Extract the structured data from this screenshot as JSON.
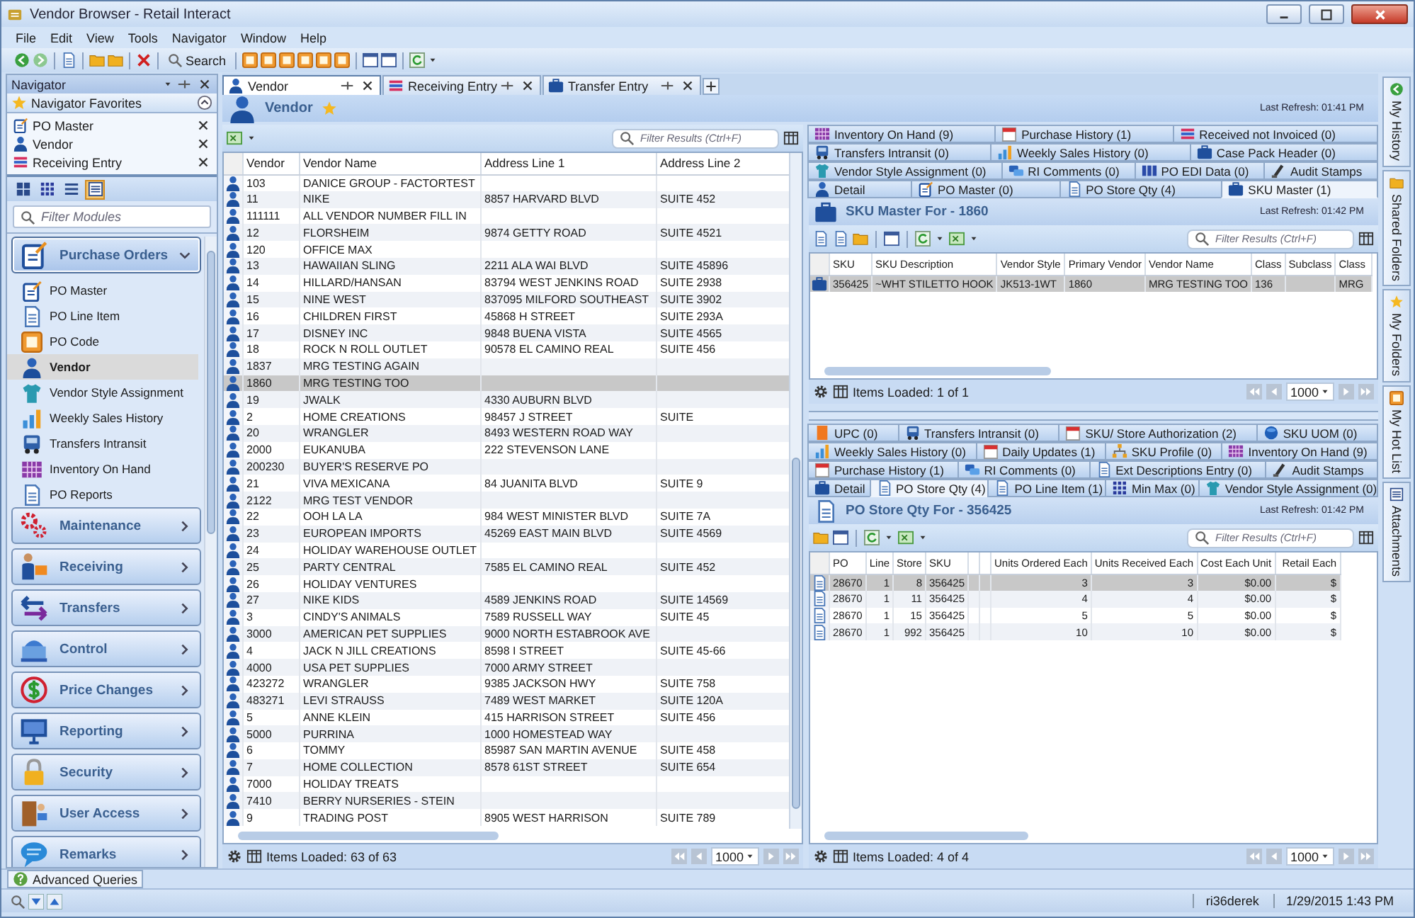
{
  "window": {
    "title": "Vendor Browser - Retail Interact"
  },
  "menu": [
    "File",
    "Edit",
    "View",
    "Tools",
    "Navigator",
    "Window",
    "Help"
  ],
  "toolbar": {
    "search_label": "Search"
  },
  "navigator": {
    "title": "Navigator",
    "favorites_title": "Navigator Favorites",
    "favorites": [
      "PO Master",
      "Vendor",
      "Receiving Entry"
    ],
    "view_modes": [
      {
        "selected": false
      },
      {
        "selected": false
      },
      {
        "selected": false
      },
      {
        "selected": true
      }
    ],
    "filter_placeholder": "Filter Modules",
    "groups": [
      {
        "label": "Purchase Orders",
        "expanded": true,
        "items": [
          {
            "label": "PO Master",
            "selected": false
          },
          {
            "label": "PO Line Item",
            "selected": false
          },
          {
            "label": "PO Code",
            "selected": false
          },
          {
            "label": "Vendor",
            "selected": true
          },
          {
            "label": "Vendor Style Assignment",
            "selected": false
          },
          {
            "label": "Weekly Sales History",
            "selected": false
          },
          {
            "label": "Transfers Intransit",
            "selected": false
          },
          {
            "label": "Inventory On Hand",
            "selected": false
          },
          {
            "label": "PO Reports",
            "selected": false
          }
        ]
      },
      {
        "label": "Maintenance",
        "expanded": false
      },
      {
        "label": "Receiving",
        "expanded": false
      },
      {
        "label": "Transfers",
        "expanded": false
      },
      {
        "label": "Control",
        "expanded": false
      },
      {
        "label": "Price Changes",
        "expanded": false
      },
      {
        "label": "Reporting",
        "expanded": false
      },
      {
        "label": "Security",
        "expanded": false
      },
      {
        "label": "User Access",
        "expanded": false
      },
      {
        "label": "Remarks",
        "expanded": false
      }
    ],
    "advanced_queries": "Advanced Queries"
  },
  "document_tabs": [
    {
      "label": "Vendor",
      "selected": true
    },
    {
      "label": "Receiving Entry",
      "selected": false
    },
    {
      "label": "Transfer Entry",
      "selected": false
    }
  ],
  "document": {
    "title": "Vendor",
    "last_refresh": "Last Refresh: 01:41 PM"
  },
  "vendor_grid": {
    "filter_placeholder": "Filter Results (Ctrl+F)",
    "columns": [
      "Vendor",
      "Vendor Name",
      "Address Line 1",
      "Address Line 2"
    ],
    "rows": [
      {
        "cells": [
          "103",
          "DANICE GROUP - FACTORTEST"
        ],
        "selected": false
      },
      {
        "cells": [
          "11",
          "NIKE",
          "8857 HARVARD BLVD",
          "SUITE 452"
        ],
        "selected": false
      },
      {
        "cells": [
          "111111",
          "ALL VENDOR NUMBER FILL IN"
        ],
        "selected": false
      },
      {
        "cells": [
          "12",
          "FLORSHEIM",
          "9874 GETTY ROAD",
          "SUITE 4521"
        ],
        "selected": false
      },
      {
        "cells": [
          "120",
          "OFFICE MAX"
        ],
        "selected": false
      },
      {
        "cells": [
          "13",
          "HAWAIIAN SLING",
          "2211 ALA WAI BLVD",
          "SUITE 45896"
        ],
        "selected": false
      },
      {
        "cells": [
          "14",
          "HILLARD/HANSAN",
          "83794 WEST JENKINS ROAD",
          "SUITE 2938"
        ],
        "selected": false
      },
      {
        "cells": [
          "15",
          "NINE WEST",
          "837095 MILFORD SOUTHEAST",
          "SUITE 3902"
        ],
        "selected": false
      },
      {
        "cells": [
          "16",
          "CHILDREN FIRST",
          "45868 H STREET",
          "SUITE 293A"
        ],
        "selected": false
      },
      {
        "cells": [
          "17",
          "DISNEY INC",
          "9848 BUENA VISTA",
          "SUITE 4565"
        ],
        "selected": false
      },
      {
        "cells": [
          "18",
          "ROCK N ROLL OUTLET",
          "90578 EL CAMINO REAL",
          "SUITE 456"
        ],
        "selected": false
      },
      {
        "cells": [
          "1837",
          "MRG TESTING AGAIN"
        ],
        "selected": false
      },
      {
        "cells": [
          "1860",
          "MRG TESTING TOO"
        ],
        "selected": true
      },
      {
        "cells": [
          "19",
          "JWALK",
          "4330 AUBURN BLVD"
        ],
        "selected": false
      },
      {
        "cells": [
          "2",
          "HOME CREATIONS",
          "98457 J STREET",
          "SUITE"
        ],
        "selected": false
      },
      {
        "cells": [
          "20",
          "WRANGLER",
          "8493 WESTERN ROAD WAY"
        ],
        "selected": false
      },
      {
        "cells": [
          "2000",
          "EUKANUBA",
          "222 STEVENSON LANE"
        ],
        "selected": false
      },
      {
        "cells": [
          "200230",
          "BUYER'S RESERVE PO"
        ],
        "selected": false
      },
      {
        "cells": [
          "21",
          "VIVA MEXICANA",
          "84 JUANITA BLVD",
          "SUITE 9"
        ],
        "selected": false
      },
      {
        "cells": [
          "2122",
          "MRG TEST VENDOR"
        ],
        "selected": false
      },
      {
        "cells": [
          "22",
          "OOH LA LA",
          "984 WEST MINISTER BLVD",
          "SUITE 7A"
        ],
        "selected": false
      },
      {
        "cells": [
          "23",
          "EUROPEAN IMPORTS",
          "45269 EAST MAIN BLVD",
          "SUITE 4569"
        ],
        "selected": false
      },
      {
        "cells": [
          "24",
          "HOLIDAY WAREHOUSE OUTLET"
        ],
        "selected": false
      },
      {
        "cells": [
          "25",
          "PARTY CENTRAL",
          "7585 EL CAMINO REAL",
          "SUITE 452"
        ],
        "selected": false
      },
      {
        "cells": [
          "26",
          "HOLIDAY VENTURES"
        ],
        "selected": false
      },
      {
        "cells": [
          "27",
          "NIKE KIDS",
          "4589 JENKINS ROAD",
          "SUITE 14569"
        ],
        "selected": false
      },
      {
        "cells": [
          "3",
          "CINDY'S ANIMALS",
          "7589 RUSSELL WAY",
          "SUITE 45"
        ],
        "selected": false
      },
      {
        "cells": [
          "3000",
          "AMERICAN PET SUPPLIES",
          "9000 NORTH ESTABROOK AVE"
        ],
        "selected": false
      },
      {
        "cells": [
          "4",
          "JACK N JILL CREATIONS",
          "8598 I STREET",
          "SUITE 45-66"
        ],
        "selected": false
      },
      {
        "cells": [
          "4000",
          "USA PET SUPPLIES",
          "7000 ARMY STREET"
        ],
        "selected": false
      },
      {
        "cells": [
          "423272",
          "WRANGLER",
          "9385 JACKSON HWY",
          "SUITE 758"
        ],
        "selected": false
      },
      {
        "cells": [
          "483271",
          "LEVI STRAUSS",
          "7489 WEST MARKET",
          "SUITE 120A"
        ],
        "selected": false
      },
      {
        "cells": [
          "5",
          "ANNE KLEIN",
          "415 HARRISON STREET",
          "SUITE 456"
        ],
        "selected": false
      },
      {
        "cells": [
          "5000",
          "PURRINA",
          "1000 HOMESTEAD WAY"
        ],
        "selected": false
      },
      {
        "cells": [
          "6",
          "TOMMY",
          "85987 SAN MARTIN AVENUE",
          "SUITE 458"
        ],
        "selected": false
      },
      {
        "cells": [
          "7",
          "HOME COLLECTION",
          "8578 61ST STREET",
          "SUITE 654"
        ],
        "selected": false
      },
      {
        "cells": [
          "7000",
          "HOLIDAY TREATS"
        ],
        "selected": false
      },
      {
        "cells": [
          "7410",
          "BERRY NURSERIES - STEIN"
        ],
        "selected": false
      },
      {
        "cells": [
          "9",
          "TRADING POST",
          "8905 WEST HARRISON",
          "SUITE 789"
        ],
        "selected": false
      }
    ],
    "items_loaded": "Items Loaded: 63 of 63",
    "page_size": "1000"
  },
  "sku_panel": {
    "tab_rows": [
      [
        {
          "label": "Inventory On Hand (9)",
          "selected": false
        },
        {
          "label": "Purchase History (1)",
          "selected": false
        },
        {
          "label": "Received not Invoiced (0)",
          "selected": false
        }
      ],
      [
        {
          "label": "Transfers Intransit (0)",
          "selected": false
        },
        {
          "label": "Weekly Sales History (0)",
          "selected": false
        },
        {
          "label": "Case Pack Header (0)",
          "selected": false
        }
      ],
      [
        {
          "label": "Vendor Style Assignment (0)",
          "selected": false
        },
        {
          "label": "RI Comments (0)",
          "selected": false
        },
        {
          "label": "PO EDI Data (0)",
          "selected": false
        },
        {
          "label": "Audit Stamps",
          "selected": false
        }
      ],
      [
        {
          "label": "Detail",
          "selected": false
        },
        {
          "label": "PO Master (0)",
          "selected": false
        },
        {
          "label": "PO Store Qty (4)",
          "selected": false
        },
        {
          "label": "SKU Master (1)",
          "selected": true
        }
      ]
    ],
    "title": "SKU Master For - 1860",
    "last_refresh": "Last Refresh: 01:42 PM",
    "filter_placeholder": "Filter Results (Ctrl+F)",
    "columns": [
      "SKU",
      "SKU Description",
      "Vendor Style",
      "Primary Vendor",
      "Vendor Name",
      "Class",
      "Subclass",
      "Class"
    ],
    "rows": [
      {
        "cells": [
          "356425",
          "~WHT STILETTO HOOK",
          "JK513-1WT",
          "1860",
          "MRG TESTING TOO",
          "136",
          null,
          "MRG"
        ],
        "selected": true
      }
    ],
    "items_loaded": "Items Loaded: 1 of 1",
    "page_size": "1000"
  },
  "store_panel": {
    "tab_rows": [
      [
        {
          "label": "UPC (0)",
          "selected": false
        },
        {
          "label": "Transfers Intransit (0)",
          "selected": false
        },
        {
          "label": "SKU/ Store Authorization (2)",
          "selected": false
        },
        {
          "label": "SKU UOM (0)",
          "selected": false
        }
      ],
      [
        {
          "label": "Weekly Sales History (0)",
          "selected": false
        },
        {
          "label": "Daily Updates (1)",
          "selected": false
        },
        {
          "label": "SKU Profile (0)",
          "selected": false
        },
        {
          "label": "Inventory On Hand (9)",
          "selected": false
        }
      ],
      [
        {
          "label": "Purchase History (1)",
          "selected": false
        },
        {
          "label": "RI Comments (0)",
          "selected": false
        },
        {
          "label": "Ext Descriptions Entry (0)",
          "selected": false
        },
        {
          "label": "Audit Stamps",
          "selected": false
        }
      ],
      [
        {
          "label": "Detail",
          "selected": false
        },
        {
          "label": "PO Store Qty (4)",
          "selected": true
        },
        {
          "label": "PO Line Item (1)",
          "selected": false
        },
        {
          "label": "Min Max (0)",
          "selected": false
        },
        {
          "label": "Vendor Style Assignment (0)",
          "selected": false
        }
      ]
    ],
    "title": "PO Store Qty For - 356425",
    "last_refresh": "Last Refresh: 01:42 PM",
    "filter_placeholder": "Filter Results (Ctrl+F)",
    "columns": [
      "PO",
      "Line",
      "Store",
      "SKU",
      "Units Ordered Each",
      "Units Received Each",
      "Cost Each Unit",
      "Retail Each"
    ],
    "rows": [
      {
        "cells": [
          "28670",
          "1",
          "8",
          "356425",
          "3",
          "3",
          "$0.00",
          "$"
        ],
        "selected": true
      },
      {
        "cells": [
          "28670",
          "1",
          "11",
          "356425",
          "4",
          "4",
          "$0.00",
          "$"
        ],
        "selected": false
      },
      {
        "cells": [
          "28670",
          "1",
          "15",
          "356425",
          "5",
          "5",
          "$0.00",
          "$"
        ],
        "selected": false
      },
      {
        "cells": [
          "28670",
          "1",
          "992",
          "356425",
          "10",
          "10",
          "$0.00",
          "$"
        ],
        "selected": false
      }
    ],
    "items_loaded": "Items Loaded: 4 of 4",
    "page_size": "1000"
  },
  "side_tabs": [
    "My History",
    "Shared Folders",
    "My Folders",
    "My Hot List",
    "Attachments"
  ],
  "status_bar": {
    "user": "ri36derek",
    "datetime": "1/29/2015 1:43 PM"
  }
}
